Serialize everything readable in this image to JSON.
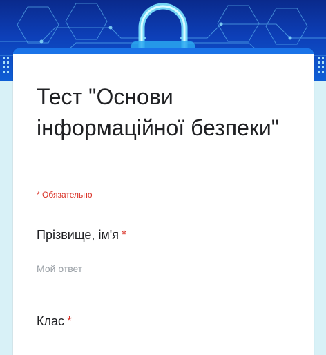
{
  "form": {
    "title": "Тест \"Основи інформаційної безпеки\"",
    "required_note": "* Обязательно",
    "questions": [
      {
        "label": "Прізвище, ім'я",
        "required_mark": "*",
        "placeholder": "Мой ответ"
      },
      {
        "label": "Клас",
        "required_mark": "*"
      }
    ]
  },
  "colors": {
    "accent": "#1a73e8",
    "required": "#d93025",
    "banner_dark": "#0a2a8c",
    "page_background": "#dff3f8"
  }
}
